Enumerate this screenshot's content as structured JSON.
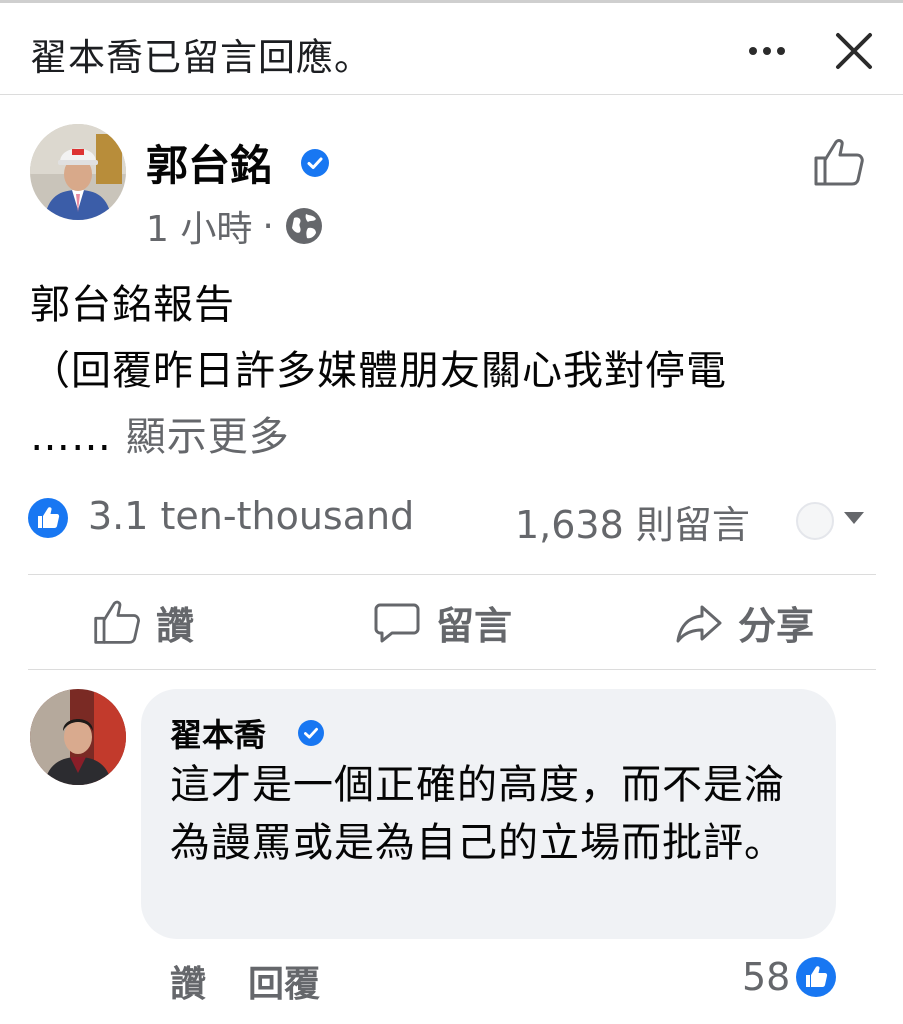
{
  "header": {
    "title": "翟本喬已留言回應。"
  },
  "post": {
    "author": "郭台銘",
    "time": "1 小時",
    "separator": "·",
    "body_line1": "郭台銘報告",
    "body_line2": "（回覆昨日許多媒體朋友關心我對停電",
    "ellipsis": "……",
    "see_more": "顯示更多",
    "like_count": "3.1 ten-thousand",
    "comment_count": "1,638 則留言"
  },
  "actions": {
    "like": "讚",
    "comment": "留言",
    "share": "分享"
  },
  "comment": {
    "author": "翟本喬",
    "text": "這才是一個正確的高度，而不是淪為謾罵或是為自己的立場而批評。",
    "like_label": "讚",
    "reply_label": "回覆",
    "reaction_count": "58"
  },
  "colors": {
    "facebook_blue": "#1877f2",
    "secondary_text": "#65676b",
    "bubble_bg": "#f0f2f5"
  }
}
